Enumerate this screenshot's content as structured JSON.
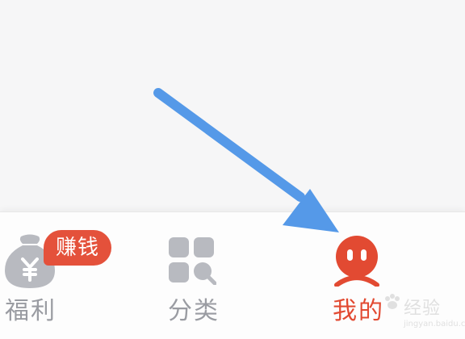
{
  "tabbar": {
    "items": [
      {
        "label": "福利",
        "icon": "money-bag-icon",
        "badge": "赚钱",
        "active": false
      },
      {
        "label": "分类",
        "icon": "category-grid-icon",
        "active": false
      },
      {
        "label": "我的",
        "icon": "profile-face-icon",
        "active": true
      }
    ]
  },
  "watermark": {
    "text": "经验",
    "sub": "jingyan.baidu.com"
  },
  "colors": {
    "accent": "#e24a32",
    "badge": "#e4513b",
    "inactive_icon": "#b8bac0",
    "inactive_text": "#9a9ca2",
    "arrow": "#5599e8",
    "background": "#f6f6f7"
  }
}
